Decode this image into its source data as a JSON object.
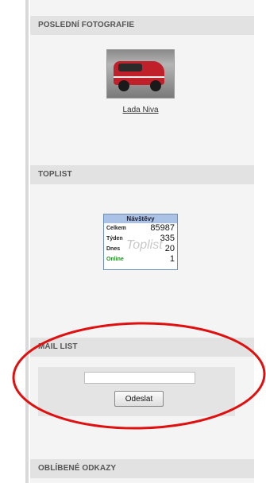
{
  "sections": {
    "recent_photos": {
      "title": "POSLEDNÍ FOTOGRAFIE",
      "photo_caption": "Lada Niva"
    },
    "toplist": {
      "title": "TOPLIST",
      "counter": {
        "header": "Návštěvy",
        "rows": [
          {
            "label": "Celkem",
            "value": "85987"
          },
          {
            "label": "Týden",
            "value": "335"
          },
          {
            "label": "Dnes",
            "value": "20"
          },
          {
            "label": "Online",
            "value": "1"
          }
        ],
        "watermark": "Toplist"
      }
    },
    "mail_list": {
      "title": "MAIL LIST",
      "email_value": "",
      "submit_label": "Odeslat"
    },
    "favorite_links": {
      "title": "OBLÍBENÉ ODKAZY"
    }
  },
  "colors": {
    "sidebar_bg": "#f4f4f4",
    "header_bg": "#e2e2e2",
    "counter_header": "#a9c2e6",
    "annotation": "#e01010",
    "online_green": "#2b8a2b"
  },
  "icons": [
    "photo-thumbnail",
    "toplist-counter-badge"
  ]
}
